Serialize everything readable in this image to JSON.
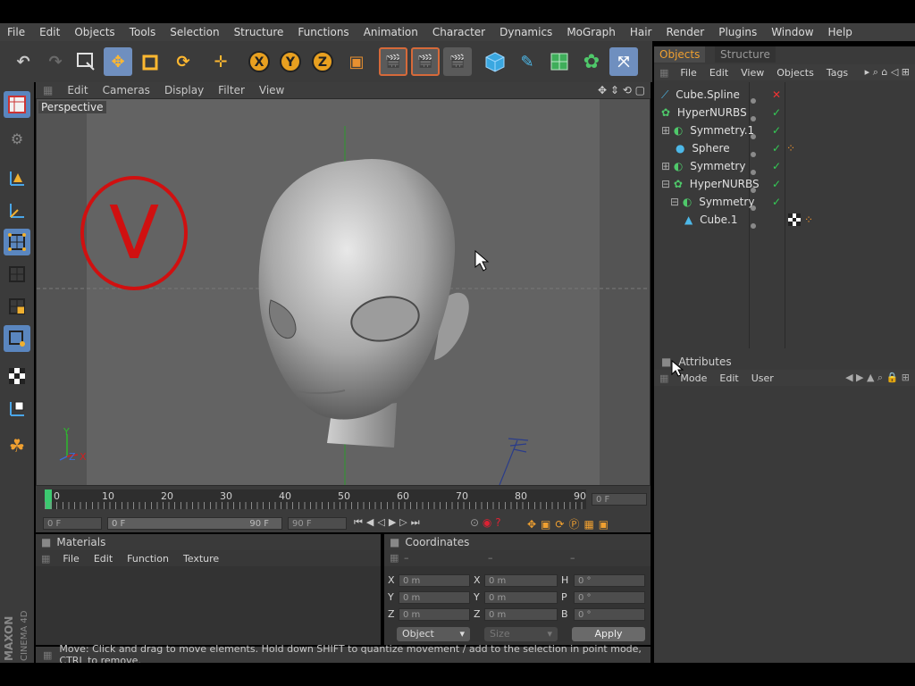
{
  "menu": [
    "File",
    "Edit",
    "Objects",
    "Tools",
    "Selection",
    "Structure",
    "Functions",
    "Animation",
    "Character",
    "Dynamics",
    "MoGraph",
    "Hair",
    "Render",
    "Plugins",
    "Window",
    "Help"
  ],
  "viewport": {
    "menu": [
      "Edit",
      "Cameras",
      "Display",
      "Filter",
      "View"
    ],
    "label": "Perspective",
    "annotation_letter": "V",
    "axis_y": "Y",
    "axis_z": "Z",
    "axis_x": "X"
  },
  "timeline": {
    "ticks": [
      "0",
      "10",
      "20",
      "30",
      "40",
      "50",
      "60",
      "70",
      "80",
      "90"
    ],
    "current_frame": "0 F"
  },
  "transport": {
    "start": "0 F",
    "range_start": "0 F",
    "range_end": "90 F",
    "end": "90 F"
  },
  "materials": {
    "title": "Materials",
    "menu": [
      "File",
      "Edit",
      "Function",
      "Texture"
    ]
  },
  "coordinates": {
    "title": "Coordinates",
    "dash": "–",
    "rows": [
      {
        "a": "X",
        "av": "0 m",
        "b": "X",
        "bv": "0 m",
        "c": "H",
        "cv": "0 °"
      },
      {
        "a": "Y",
        "av": "0 m",
        "b": "Y",
        "bv": "0 m",
        "c": "P",
        "cv": "0 °"
      },
      {
        "a": "Z",
        "av": "0 m",
        "b": "Z",
        "bv": "0 m",
        "c": "B",
        "cv": "0 °"
      }
    ],
    "mode": "Object",
    "size": "Size",
    "apply": "Apply"
  },
  "status": "Move: Click and drag to move elements. Hold down SHIFT to quantize movement / add to the selection in point mode, CTRL to remove.",
  "objects_panel": {
    "tabs": [
      "Objects",
      "Structure"
    ],
    "menu": [
      "File",
      "Edit",
      "View",
      "Objects",
      "Tags"
    ],
    "items": [
      {
        "name": "Cube.Spline",
        "indent": 0,
        "state": "x"
      },
      {
        "name": "HyperNURBS",
        "indent": 0,
        "state": "check"
      },
      {
        "name": "Symmetry.1",
        "indent": 0,
        "state": "check"
      },
      {
        "name": "Sphere",
        "indent": 1,
        "state": "check"
      },
      {
        "name": "Symmetry",
        "indent": 0,
        "state": "check"
      },
      {
        "name": "HyperNURBS",
        "indent": 0,
        "state": "check"
      },
      {
        "name": "Symmetry",
        "indent": 1,
        "state": "check"
      },
      {
        "name": "Cube.1",
        "indent": 2,
        "state": "none"
      }
    ]
  },
  "attributes": {
    "title": "Attributes",
    "menu": [
      "Mode",
      "Edit",
      "User"
    ]
  },
  "brand": "MAXON CINEMA 4D"
}
